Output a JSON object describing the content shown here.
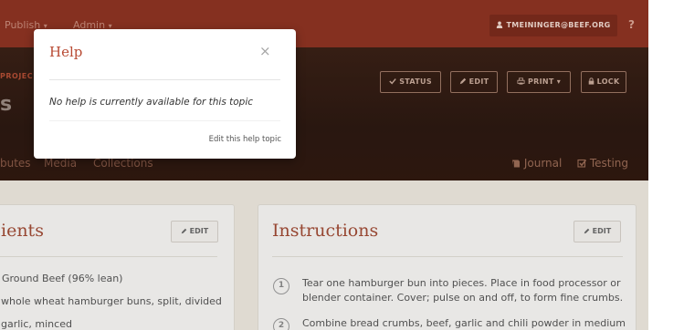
{
  "nav": {
    "links": [
      {
        "label": "Publish",
        "caret": "▾"
      },
      {
        "label": "Admin",
        "caret": "▾"
      }
    ],
    "user_label": "TMEININGER@BEEF.ORG",
    "help_label": "?"
  },
  "hero": {
    "crumb": "PROJEC",
    "title": "s",
    "buttons": [
      {
        "label": "STATUS",
        "icon": "check-icon"
      },
      {
        "label": "EDIT",
        "icon": "pencil-icon"
      },
      {
        "label": "PRINT",
        "icon": "print-icon"
      },
      {
        "label": "LOCK",
        "icon": "lock-icon"
      }
    ],
    "tabs": [
      "butes",
      "Media",
      "Collections"
    ],
    "right_tabs": [
      {
        "label": "Journal",
        "icon": "book-icon"
      },
      {
        "label": "Testing",
        "icon": "checkbox-icon"
      }
    ]
  },
  "ingredients": {
    "title": "ients",
    "edit_label": "EDIT",
    "lines": [
      "Ground Beef (96% lean)",
      "whole wheat hamburger buns, split, divided",
      "garlic, minced"
    ]
  },
  "instructions": {
    "title": "Instructions",
    "edit_label": "EDIT",
    "steps": [
      {
        "num": "1",
        "text": "Tear one hamburger bun into pieces. Place in food processor or blender container. Cover; pulse on and off, to form fine crumbs."
      },
      {
        "num": "2",
        "text": "Combine bread crumbs, beef, garlic and chili powder in medium"
      }
    ]
  },
  "modal": {
    "title": "Help",
    "close": "×",
    "body": "No help is currently available for this topic",
    "link": "Edit this help topic"
  },
  "colors": {
    "navbar": "#8e3422",
    "hero": "#2c1912",
    "accent": "#b84a33",
    "page_bg": "#ede8df"
  }
}
